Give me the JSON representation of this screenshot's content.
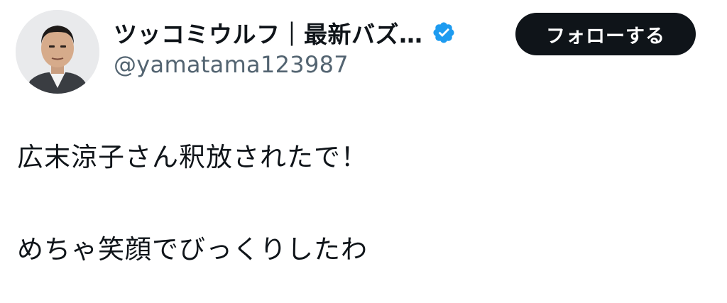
{
  "author": {
    "display_name": "ツッコミウルフ｜最新バズ…",
    "handle": "@yamatama123987",
    "verified_icon": "verified-badge-icon",
    "verified_color": "#1d9bf0",
    "avatar_icon": "avatar-photo"
  },
  "follow_button": {
    "label": "フォローする",
    "background": "#0f1419",
    "text_color": "#ffffff"
  },
  "tweet": {
    "lines": [
      "広末涼子さん釈放されたで！",
      "めちゃ笑顔でびっくりしたわ"
    ]
  }
}
